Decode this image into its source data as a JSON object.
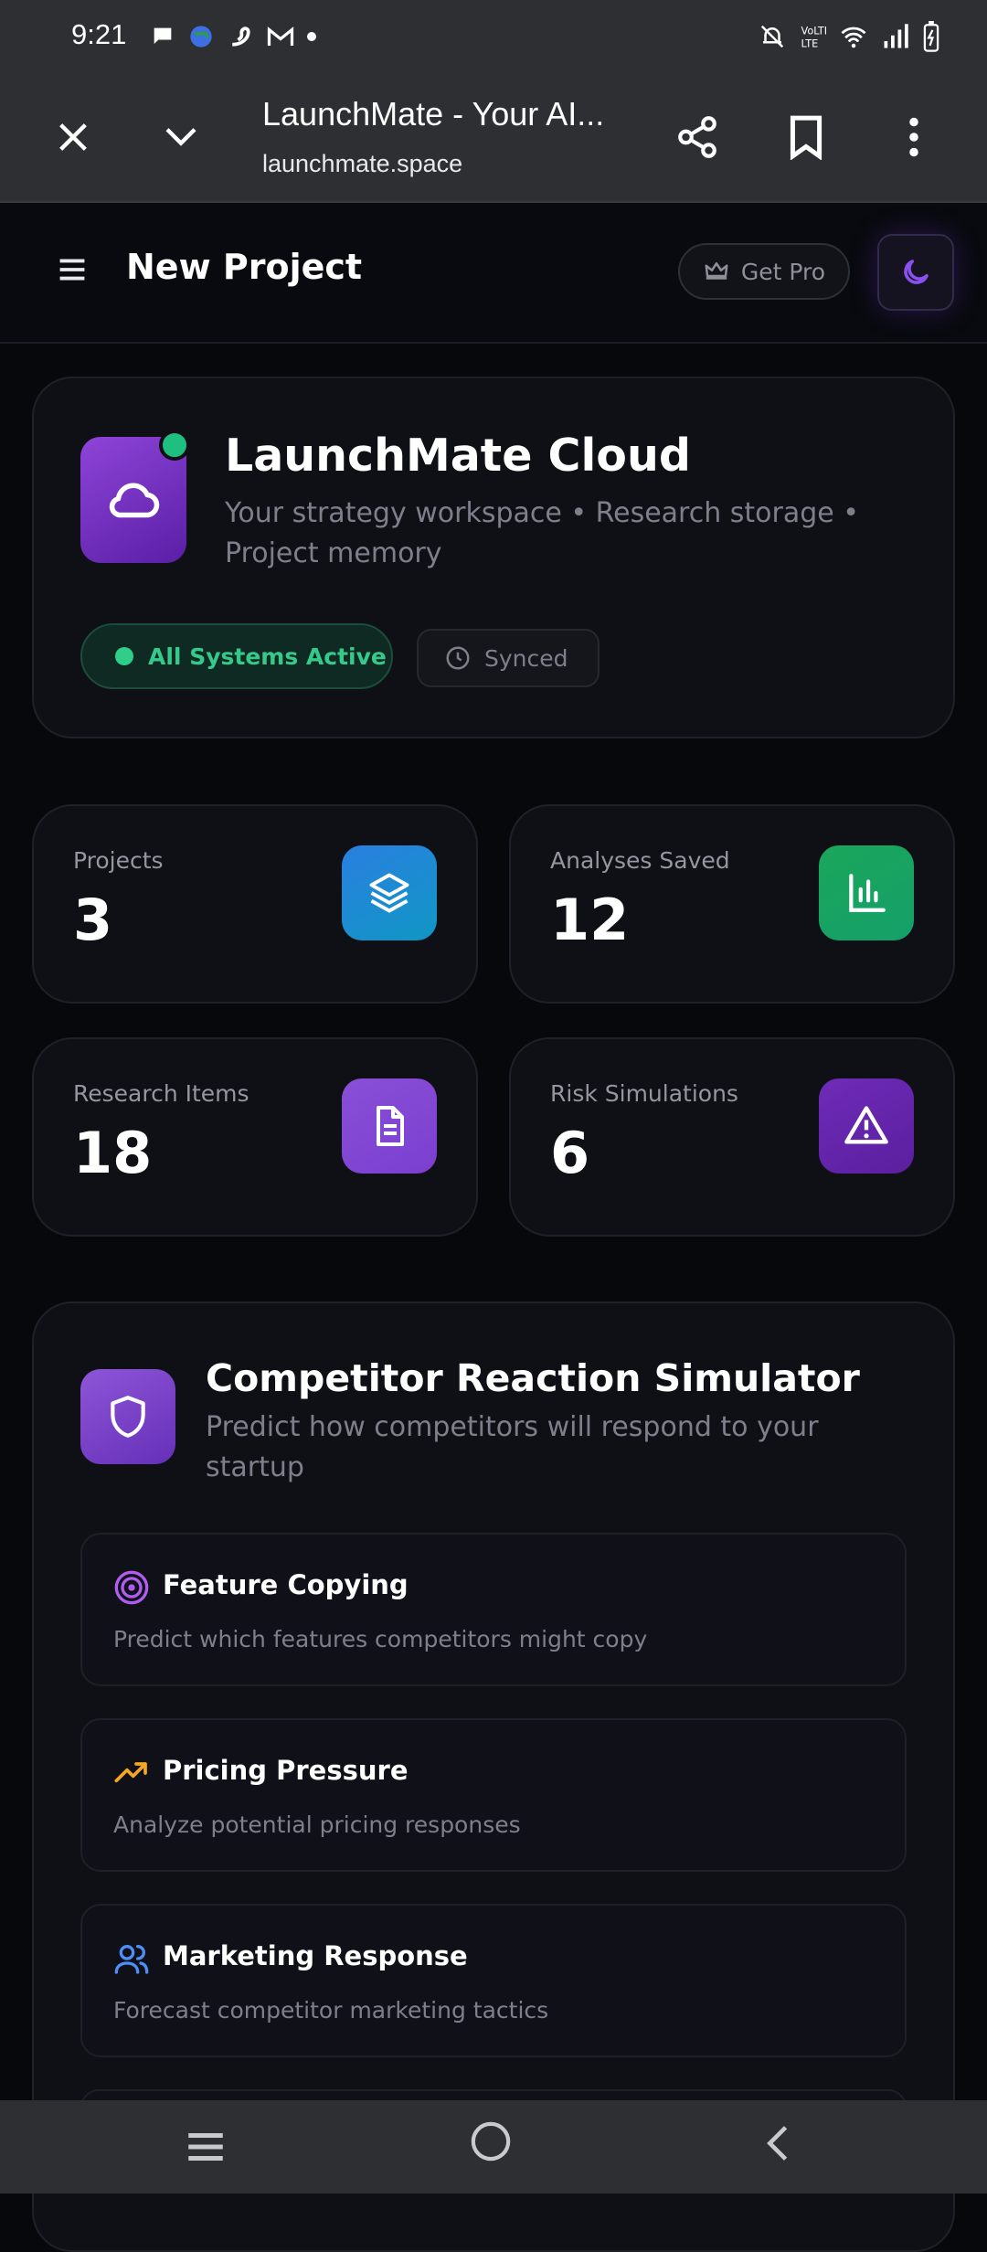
{
  "status_bar": {
    "time": "9:21"
  },
  "browser": {
    "title": "LaunchMate - Your AI...",
    "url": "launchmate.space"
  },
  "header": {
    "title": "New Project",
    "get_pro_label": "Get Pro"
  },
  "hero": {
    "title": "LaunchMate Cloud",
    "description": "Your strategy workspace • Research storage • Project memory",
    "status_active": "All Systems Active",
    "status_synced": "Synced"
  },
  "stats": [
    {
      "label": "Projects",
      "value": "3",
      "icon": "layers-icon",
      "color": "#1f8fd6"
    },
    {
      "label": "Analyses Saved",
      "value": "12",
      "icon": "bar-chart-icon",
      "color": "#19a35a"
    },
    {
      "label": "Research Items",
      "value": "18",
      "icon": "document-icon",
      "color": "#8a4fd6"
    },
    {
      "label": "Risk Simulations",
      "value": "6",
      "icon": "warning-icon",
      "color": "#6a26b3"
    }
  ],
  "simulator": {
    "title": "Competitor Reaction Simulator",
    "description": "Predict how competitors will respond to your startup",
    "features": [
      {
        "title": "Feature Copying",
        "description": "Predict which features competitors might copy",
        "icon": "target-icon",
        "color": "#b15cf0"
      },
      {
        "title": "Pricing Pressure",
        "description": "Analyze potential pricing responses",
        "icon": "trend-up-icon",
        "color": "#f5a623"
      },
      {
        "title": "Marketing Response",
        "description": "Forecast competitor marketing tactics",
        "icon": "users-icon",
        "color": "#4e8ef7"
      }
    ]
  },
  "colors": {
    "accent": "#7c3aed",
    "success": "#2fcf8a",
    "background": "#07080c",
    "card": "#0f1016"
  }
}
